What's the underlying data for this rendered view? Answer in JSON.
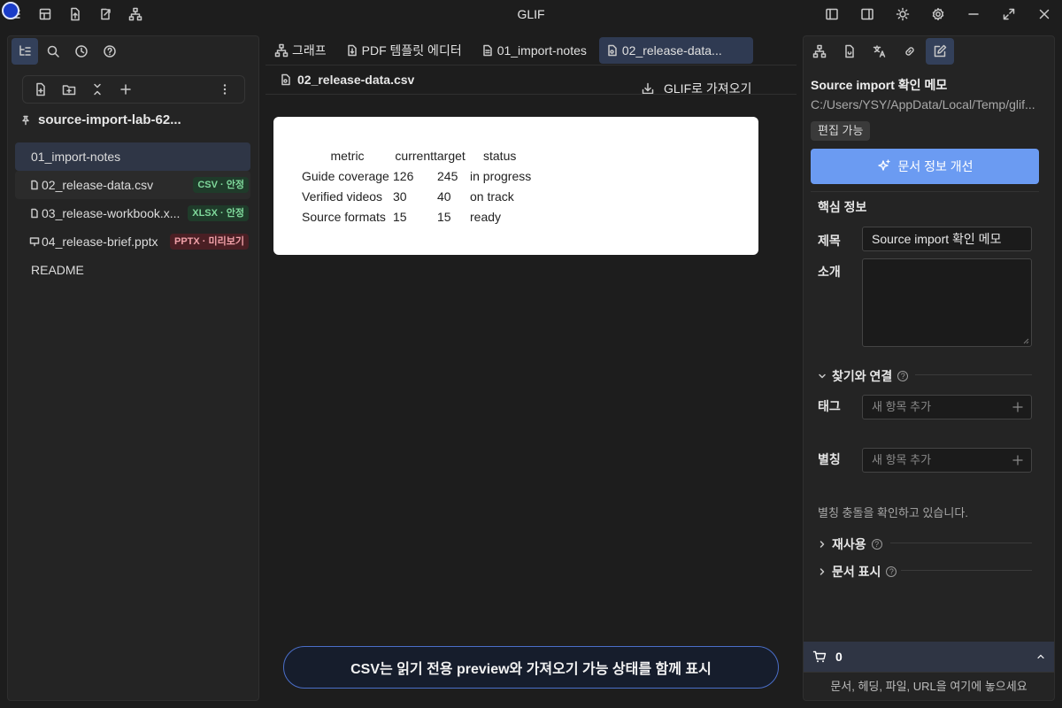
{
  "app": {
    "title": "GLIF"
  },
  "left_panel": {
    "vault_name": "source-import-lab-62...",
    "files": [
      {
        "name": "01_import-notes",
        "badge": ""
      },
      {
        "name": "02_release-data.csv",
        "badge": "CSV · 안정"
      },
      {
        "name": "03_release-workbook.x...",
        "badge": "XLSX · 안정"
      },
      {
        "name": "04_release-brief.pptx",
        "badge": "PPTX · 미리보기"
      },
      {
        "name": "README",
        "badge": ""
      }
    ]
  },
  "center": {
    "tabs": [
      {
        "label": "그래프"
      },
      {
        "label": "PDF 템플릿 에디터"
      },
      {
        "label": "01_import-notes"
      },
      {
        "label": "02_release-data..."
      }
    ],
    "file_title": "02_release-data.csv",
    "import_button": "GLIF로 가져오기",
    "table": {
      "headers": [
        "metric",
        "current",
        "target",
        "status"
      ],
      "rows": [
        [
          "Guide coverage",
          "126",
          "245",
          "in progress"
        ],
        [
          "Verified videos",
          "30",
          "40",
          "on track"
        ],
        [
          "Source formats",
          "15",
          "15",
          "ready"
        ]
      ]
    },
    "banner": "CSV는 읽기 전용 preview와 가져오기 가능 상태를 함께 표시"
  },
  "right_panel": {
    "doc_title": "Source import 확인 메모",
    "doc_path": "C:/Users/YSY/AppData/Local/Temp/glif...",
    "edit_chip": "편집 가능",
    "improve_button": "문서 정보 개선",
    "core_section": "핵심 정보",
    "title_label": "제목",
    "title_value": "Source import 확인 메모",
    "intro_label": "소개",
    "find_link_section": "찾기와 연결",
    "tags_label": "태그",
    "tags_placeholder": "새 항목 추가",
    "alias_label": "별칭",
    "alias_placeholder": "새 항목 추가",
    "alias_note": "별칭 충돌을 확인하고 있습니다.",
    "reuse_section": "재사용",
    "display_section": "문서 표시",
    "cart_count": "0",
    "drop_hint": "문서, 헤딩, 파일, URL을 여기에 놓으세요"
  },
  "colors": {
    "accent": "#6b9bf2",
    "active_tab": "#2f3a52",
    "badge_green": "#7fd89b",
    "badge_red": "#f0a0a8"
  }
}
